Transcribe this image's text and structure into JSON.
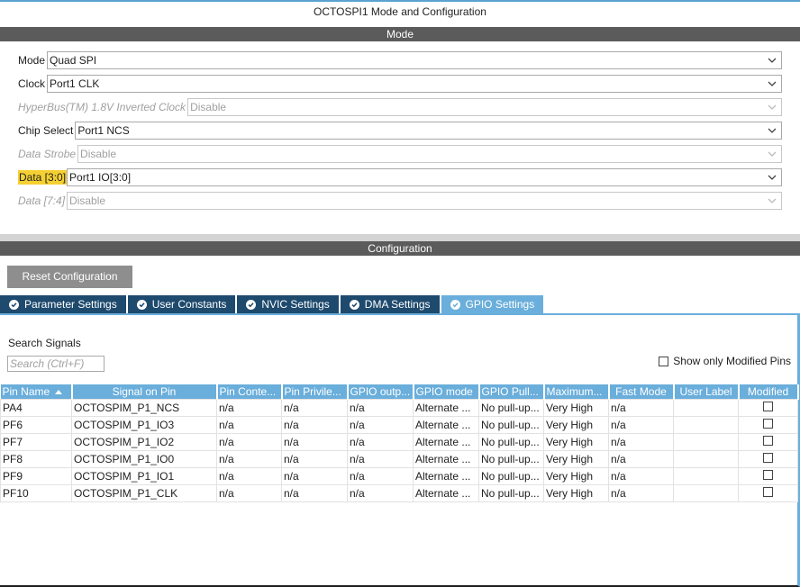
{
  "panel_title": "OCTOSPI1 Mode and Configuration",
  "mode_section": "Mode",
  "config_section": "Configuration",
  "fields": [
    {
      "label": "Mode",
      "value": "Quad SPI"
    },
    {
      "label": "Clock",
      "value": "Port1 CLK"
    },
    {
      "label": "HyperBus(TM) 1.8V Inverted Clock",
      "value": "Disable"
    },
    {
      "label": "Chip Select",
      "value": "Port1 NCS"
    },
    {
      "label": "Data Strobe",
      "value": "Disable"
    },
    {
      "label": "Data [3:0]",
      "value": "Port1 IO[3:0]"
    },
    {
      "label": "Data [7:4]",
      "value": "Disable"
    }
  ],
  "reset_button": "Reset Configuration",
  "tabs": [
    {
      "label": "Parameter Settings"
    },
    {
      "label": "User Constants"
    },
    {
      "label": "NVIC Settings"
    },
    {
      "label": "DMA Settings"
    },
    {
      "label": "GPIO Settings"
    }
  ],
  "search": {
    "label": "Search Signals",
    "placeholder": "Search (Ctrl+F)"
  },
  "show_modified_label": "Show only Modified Pins",
  "table": {
    "columns": [
      "Pin Name",
      "Signal on Pin",
      "Pin Conte...",
      "Pin Privile...",
      "GPIO outp...",
      "GPIO mode",
      "GPIO Pull...",
      "Maximum...",
      "Fast Mode",
      "User Label",
      "Modified"
    ],
    "rows": [
      [
        "PA4",
        "OCTOSPIM_P1_NCS",
        "n/a",
        "n/a",
        "n/a",
        "Alternate ...",
        "No pull-up...",
        "Very High",
        "n/a",
        ""
      ],
      [
        "PF6",
        "OCTOSPIM_P1_IO3",
        "n/a",
        "n/a",
        "n/a",
        "Alternate ...",
        "No pull-up...",
        "Very High",
        "n/a",
        ""
      ],
      [
        "PF7",
        "OCTOSPIM_P1_IO2",
        "n/a",
        "n/a",
        "n/a",
        "Alternate ...",
        "No pull-up...",
        "Very High",
        "n/a",
        ""
      ],
      [
        "PF8",
        "OCTOSPIM_P1_IO0",
        "n/a",
        "n/a",
        "n/a",
        "Alternate ...",
        "No pull-up...",
        "Very High",
        "n/a",
        ""
      ],
      [
        "PF9",
        "OCTOSPIM_P1_IO1",
        "n/a",
        "n/a",
        "n/a",
        "Alternate ...",
        "No pull-up...",
        "Very High",
        "n/a",
        ""
      ],
      [
        "PF10",
        "OCTOSPIM_P1_CLK",
        "n/a",
        "n/a",
        "n/a",
        "Alternate ...",
        "No pull-up...",
        "Very High",
        "n/a",
        ""
      ]
    ]
  }
}
